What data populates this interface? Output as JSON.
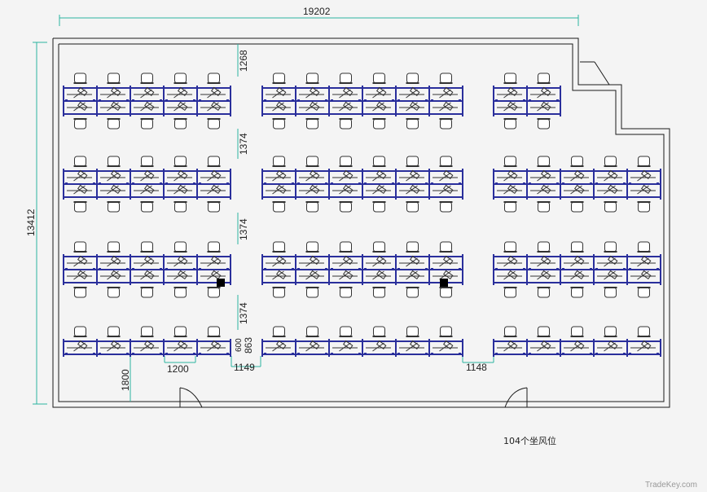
{
  "dimensions": {
    "total_width": "19202",
    "total_height": "13412",
    "gap_top": "1268",
    "gap_row_1": "1374",
    "gap_row_2": "1374",
    "gap_row_3": "1374",
    "aisle_width": "863",
    "aisle_width_small": "600",
    "desk_width": "1200",
    "bottom_offset": "1800",
    "walkway_left": "1149",
    "walkway_right": "1148"
  },
  "caption": "104个坐风位",
  "watermark": "TradeKey.com",
  "colors": {
    "line": "#1a1a1a",
    "partition": "#2a2f9c",
    "dimension": "#2bb3a0",
    "furniture": "#333333",
    "background": "#f4f4f4"
  }
}
